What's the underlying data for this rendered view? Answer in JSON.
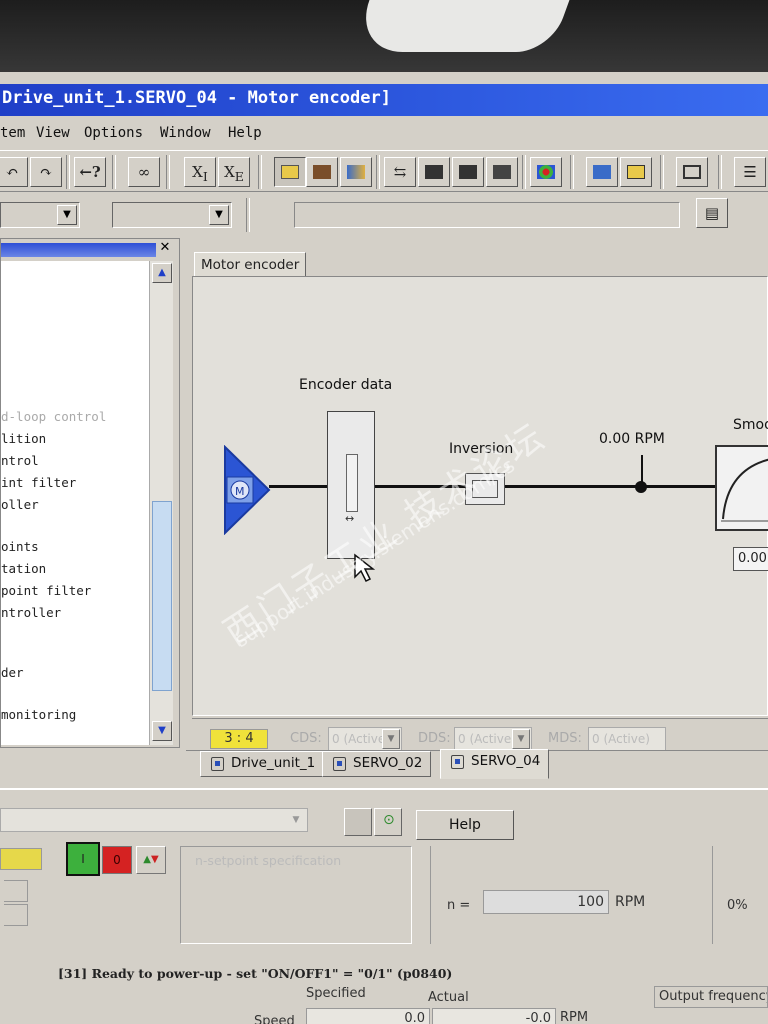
{
  "window": {
    "title": "Drive_unit_1.SERVO_04 - Motor encoder]"
  },
  "menu": {
    "items": [
      "tem",
      "View",
      "Options",
      "Window",
      "Help"
    ]
  },
  "toolbar": {
    "x_i_label": "X",
    "x_i_sub": "I",
    "x_e_label": "X",
    "x_e_sub": "E",
    "help_label": "←?"
  },
  "project_tree": {
    "items": [
      "d-loop control",
      "lition",
      "ntrol",
      "int filter",
      "oller",
      "oints",
      "tation",
      "point filter",
      "ntroller",
      "der",
      "monitoring"
    ]
  },
  "document": {
    "tab_label": "Motor encoder",
    "encoder_data_label": "Encoder data",
    "inversion_label": "Inversion",
    "speed_value": "0.00 RPM",
    "smoothing_label": "Smoo",
    "smoothing_output": "0.00"
  },
  "data_sets": {
    "indicator": "3 : 4",
    "cds_label": "CDS:",
    "cds_value": "0 (Active)",
    "dds_label": "DDS:",
    "dds_value": "0 (Active)",
    "mds_label": "MDS:",
    "mds_value": "0 (Active)"
  },
  "drive_tabs": [
    {
      "label": "Drive_unit_1",
      "active": false
    },
    {
      "label": "SERVO_02",
      "active": false
    },
    {
      "label": "SERVO_04",
      "active": true
    }
  ],
  "control_panel": {
    "help_label": "Help",
    "on_label": "I",
    "off_label": "0",
    "setpoint_label": "n-setpoint specification",
    "n_label": "n =",
    "n_value": "100",
    "n_unit": "RPM",
    "percent": "0%",
    "status_text": "[31] Ready to power-up - set \"ON/OFF1\" = \"0/1\" (p0840)",
    "speed_label": "Speed",
    "specified_label": "Specified",
    "actual_label": "Actual",
    "specified_value": "0.0",
    "actual_value": "-0.0",
    "speed_unit": "RPM",
    "output_frequency_label": "Output frequency"
  },
  "watermark": {
    "line1": "西门子工业 技术论坛",
    "line2": "support.industry.siemens.com/cs"
  },
  "colors": {
    "title_bar": "#2e5ae0",
    "motor_triangle": "#2b55d4",
    "yellow_indicator": "#f0e23a",
    "on_button": "#3db03d",
    "off_button": "#d52222"
  }
}
